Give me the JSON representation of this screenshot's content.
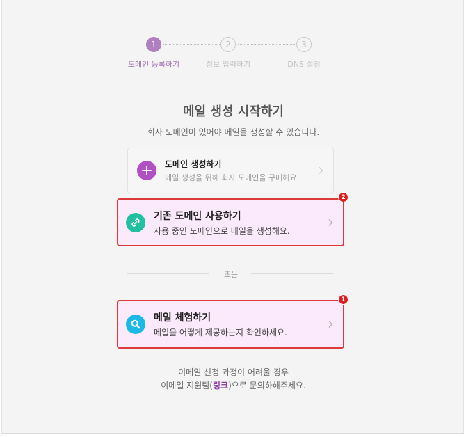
{
  "stepper": {
    "steps": [
      {
        "number": "1",
        "label": "도메인 등록하기",
        "state": "active"
      },
      {
        "number": "2",
        "label": "정보 입력하기",
        "state": "inactive"
      },
      {
        "number": "3",
        "label": "DNS 설정",
        "state": "inactive"
      }
    ]
  },
  "heading": {
    "title": "메일 생성 시작하기",
    "subtitle": "회사 도메인이 있어야 메일을 생성할 수 있습니다."
  },
  "options": {
    "create_domain": {
      "title": "도메인 생성하기",
      "description": "메일 생성을 위해 회사 도메인을 구매해요.",
      "icon": "plus-icon",
      "icon_color": "#b14fc5"
    },
    "use_existing": {
      "title": "기존 도메인 사용하기",
      "description": "사용 중인 도메인으로 메일을 생성해요.",
      "icon": "link-icon",
      "icon_color": "#22bfa0",
      "badge": "2"
    },
    "trial": {
      "title": "메일 체험하기",
      "description": "메일을 어떻게 제공하는지 확인하세요.",
      "icon": "search-icon",
      "icon_color": "#1cb8e6",
      "badge": "1"
    }
  },
  "divider_text": "또는",
  "footer": {
    "line1": "이메일 신청 과정이 어려울 경우",
    "line2_prefix": "이메일 지원팀(",
    "link_text": "링크",
    "line2_suffix": ")으로 문의하해주세요."
  },
  "colors": {
    "accent_purple": "#a371b5",
    "highlight_border": "#dc3a3a",
    "highlight_bg": "#fbeafb",
    "badge_red": "#dd1f1f"
  }
}
